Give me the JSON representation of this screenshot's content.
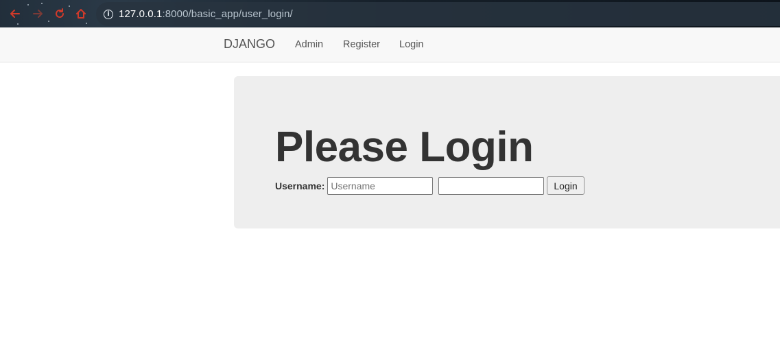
{
  "browser": {
    "url_host": "127.0.0.1",
    "url_path": ":8000/basic_app/user_login/",
    "icons": [
      "back-icon",
      "forward-icon",
      "reload-icon",
      "home-icon",
      "info-icon"
    ],
    "accent_color": "#d13a2a"
  },
  "navbar": {
    "brand": "DJANGO",
    "links": [
      "Admin",
      "Register",
      "Login"
    ]
  },
  "main": {
    "heading": "Please Login",
    "username_label": "Username:",
    "username_placeholder": "Username",
    "password_value": "",
    "login_button": "Login"
  }
}
